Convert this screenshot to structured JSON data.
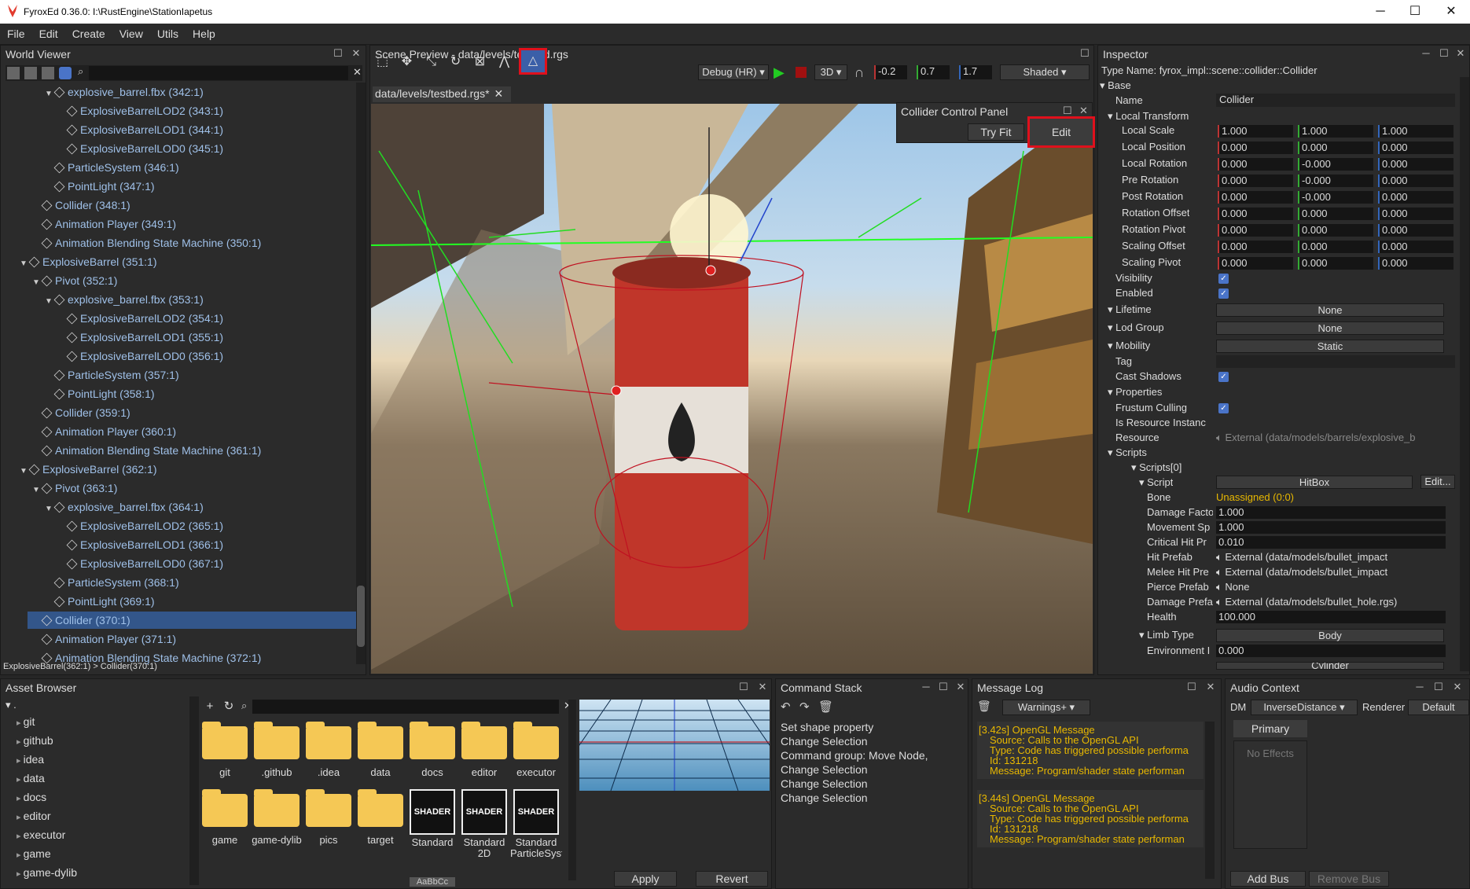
{
  "window": {
    "title": "FyroxEd  0.36.0: I:\\RustEngine\\StationIapetus",
    "minimize": "─",
    "maximize": "☐",
    "close": "✕"
  },
  "menu": [
    "File",
    "Edit",
    "Create",
    "View",
    "Utils",
    "Help"
  ],
  "world_viewer": {
    "title": "World Viewer",
    "search_placeholder": "",
    "status": "ExplosiveBarrel(362:1) > Collider(370:1)",
    "rows": [
      {
        "label": "explosive_barrel.fbx (342:1)",
        "indent": 3,
        "arrow": "▼"
      },
      {
        "label": "ExplosiveBarrelLOD2 (343:1)",
        "indent": 4,
        "arrow": ""
      },
      {
        "label": "ExplosiveBarrelLOD1 (344:1)",
        "indent": 4,
        "arrow": ""
      },
      {
        "label": "ExplosiveBarrelLOD0 (345:1)",
        "indent": 4,
        "arrow": ""
      },
      {
        "label": "ParticleSystem (346:1)",
        "indent": 3,
        "arrow": ""
      },
      {
        "label": "PointLight (347:1)",
        "indent": 3,
        "arrow": ""
      },
      {
        "label": "Collider (348:1)",
        "indent": 2,
        "arrow": ""
      },
      {
        "label": "Animation Player (349:1)",
        "indent": 2,
        "arrow": ""
      },
      {
        "label": "Animation Blending State Machine (350:1)",
        "indent": 2,
        "arrow": ""
      },
      {
        "label": "ExplosiveBarrel (351:1)",
        "indent": 1,
        "arrow": "▼"
      },
      {
        "label": "Pivot (352:1)",
        "indent": 2,
        "arrow": "▼"
      },
      {
        "label": "explosive_barrel.fbx (353:1)",
        "indent": 3,
        "arrow": "▼"
      },
      {
        "label": "ExplosiveBarrelLOD2 (354:1)",
        "indent": 4,
        "arrow": ""
      },
      {
        "label": "ExplosiveBarrelLOD1 (355:1)",
        "indent": 4,
        "arrow": ""
      },
      {
        "label": "ExplosiveBarrelLOD0 (356:1)",
        "indent": 4,
        "arrow": ""
      },
      {
        "label": "ParticleSystem (357:1)",
        "indent": 3,
        "arrow": ""
      },
      {
        "label": "PointLight (358:1)",
        "indent": 3,
        "arrow": ""
      },
      {
        "label": "Collider (359:1)",
        "indent": 2,
        "arrow": ""
      },
      {
        "label": "Animation Player (360:1)",
        "indent": 2,
        "arrow": ""
      },
      {
        "label": "Animation Blending State Machine (361:1)",
        "indent": 2,
        "arrow": ""
      },
      {
        "label": "ExplosiveBarrel (362:1)",
        "indent": 1,
        "arrow": "▼"
      },
      {
        "label": "Pivot (363:1)",
        "indent": 2,
        "arrow": "▼"
      },
      {
        "label": "explosive_barrel.fbx (364:1)",
        "indent": 3,
        "arrow": "▼"
      },
      {
        "label": "ExplosiveBarrelLOD2 (365:1)",
        "indent": 4,
        "arrow": ""
      },
      {
        "label": "ExplosiveBarrelLOD1 (366:1)",
        "indent": 4,
        "arrow": ""
      },
      {
        "label": "ExplosiveBarrelLOD0 (367:1)",
        "indent": 4,
        "arrow": ""
      },
      {
        "label": "ParticleSystem (368:1)",
        "indent": 3,
        "arrow": ""
      },
      {
        "label": "PointLight (369:1)",
        "indent": 3,
        "arrow": ""
      },
      {
        "label": "Collider (370:1)",
        "indent": 2,
        "arrow": "",
        "selected": true
      },
      {
        "label": "Animation Player (371:1)",
        "indent": 2,
        "arrow": ""
      },
      {
        "label": "Animation Blending State Machine (372:1)",
        "indent": 2,
        "arrow": ""
      }
    ]
  },
  "scene_preview": {
    "title": "Scene Preview - data/levels/testbed.rgs",
    "tab": "data/levels/testbed.rgs*",
    "build": "Debug (HR)",
    "mode": "3D",
    "cam_x": "-0.2",
    "cam_y": "0.7",
    "cam_z": "1.7",
    "shading": "Shaded",
    "collider_panel": {
      "title": "Collider Control Panel",
      "try_fit": "Try Fit",
      "edit": "Edit"
    }
  },
  "inspector": {
    "title": "Inspector",
    "type_name": "Type Name: fyrox_impl::scene::collider::Collider",
    "base": "Base",
    "name_label": "Name",
    "name_value": "Collider",
    "local_transform": "Local Transform",
    "transform_rows": [
      {
        "label": "Local Scale",
        "x": "1.000",
        "y": "1.000",
        "z": "1.000"
      },
      {
        "label": "Local Position",
        "x": "0.000",
        "y": "0.000",
        "z": "0.000"
      },
      {
        "label": "Local Rotation",
        "x": "0.000",
        "y": "-0.000",
        "z": "0.000"
      },
      {
        "label": "Pre Rotation",
        "x": "0.000",
        "y": "-0.000",
        "z": "0.000"
      },
      {
        "label": "Post Rotation",
        "x": "0.000",
        "y": "-0.000",
        "z": "0.000"
      },
      {
        "label": "Rotation Offset",
        "x": "0.000",
        "y": "0.000",
        "z": "0.000"
      },
      {
        "label": "Rotation Pivot",
        "x": "0.000",
        "y": "0.000",
        "z": "0.000"
      },
      {
        "label": "Scaling Offset",
        "x": "0.000",
        "y": "0.000",
        "z": "0.000"
      },
      {
        "label": "Scaling Pivot",
        "x": "0.000",
        "y": "0.000",
        "z": "0.000"
      }
    ],
    "visibility": "Visibility",
    "enabled": "Enabled",
    "lifetime": "Lifetime",
    "lifetime_value": "None",
    "lod_group": "Lod Group",
    "lod_value": "None",
    "mobility": "Mobility",
    "mobility_value": "Static",
    "tag": "Tag",
    "cast_shadows": "Cast Shadows",
    "properties": "Properties",
    "frustum_culling": "Frustum Culling",
    "is_resource_instance": "Is Resource Instanc",
    "resource": "Resource",
    "resource_value": "External (data/models/barrels/explosive_b",
    "scripts": "Scripts",
    "scripts0": "Scripts[0]",
    "script": "Script",
    "script_value": "HitBox",
    "script_edit": "Edit...",
    "bone": "Bone",
    "bone_value": "Unassigned (0:0)",
    "damage_factor": "Damage Facto",
    "damage_factor_value": "1.000",
    "movement_speed": "Movement Sp",
    "movement_speed_value": "1.000",
    "critical_hit": "Critical Hit Pr",
    "critical_hit_value": "0.010",
    "hit_prefab": "Hit Prefab",
    "hit_prefab_value": "External (data/models/bullet_impact",
    "melee_hit": "Melee Hit Pre",
    "melee_hit_value": "External (data/models/bullet_impact",
    "pierce_prefab": "Pierce Prefab",
    "pierce_prefab_value": "None",
    "damage_prefab": "Damage Prefa",
    "damage_prefab_value": "External (data/models/bullet_hole.rgs)",
    "health": "Health",
    "health_value": "100.000",
    "limb_type": "Limb Type",
    "limb_type_value": "Body",
    "environment": "Environment I",
    "environment_value": "0.000",
    "shape_value": "Cylinder"
  },
  "asset_browser": {
    "title": "Asset Browser",
    "tree_root": ".",
    "tree": [
      "git",
      "github",
      "idea",
      "data",
      "docs",
      "editor",
      "executor",
      "game",
      "game-dylib"
    ],
    "items_row1": [
      "git",
      ".github",
      ".idea",
      "data",
      "docs",
      "editor",
      "executor"
    ],
    "items_row2": [
      "game",
      "game-dylib",
      "pics",
      "target"
    ],
    "shaders": [
      "Standard",
      "Standard 2D",
      "Standard ParticleSystem"
    ],
    "shader_label": "SHADER",
    "swatch_text": "AaBbCc",
    "apply": "Apply",
    "revert": "Revert"
  },
  "command_stack": {
    "title": "Command Stack",
    "entries": [
      "Set shape property",
      "Change Selection",
      "Command group: Move Node,",
      "Change Selection",
      "Change Selection",
      "Change Selection"
    ]
  },
  "message_log": {
    "title": "Message Log",
    "filter": "Warnings+",
    "messages": [
      {
        "head": "[3.42s] OpenGL Message",
        "source": "Source: Calls to the OpenGL API",
        "type": "Type: Code has triggered possible performa",
        "id": "Id: 131218",
        "msg": "Message: Program/shader state performan"
      },
      {
        "head": "[3.44s] OpenGL Message",
        "source": "Source: Calls to the OpenGL API",
        "type": "Type: Code has triggered possible performa",
        "id": "Id: 131218",
        "msg": "Message: Program/shader state performan"
      }
    ]
  },
  "audio_context": {
    "title": "Audio Context",
    "dm": "DM",
    "dm_value": "InverseDistance",
    "renderer": "Renderer",
    "renderer_value": "Default",
    "bus": "Primary",
    "effects": "No Effects",
    "add_bus": "Add Bus",
    "remove_bus": "Remove Bus"
  }
}
